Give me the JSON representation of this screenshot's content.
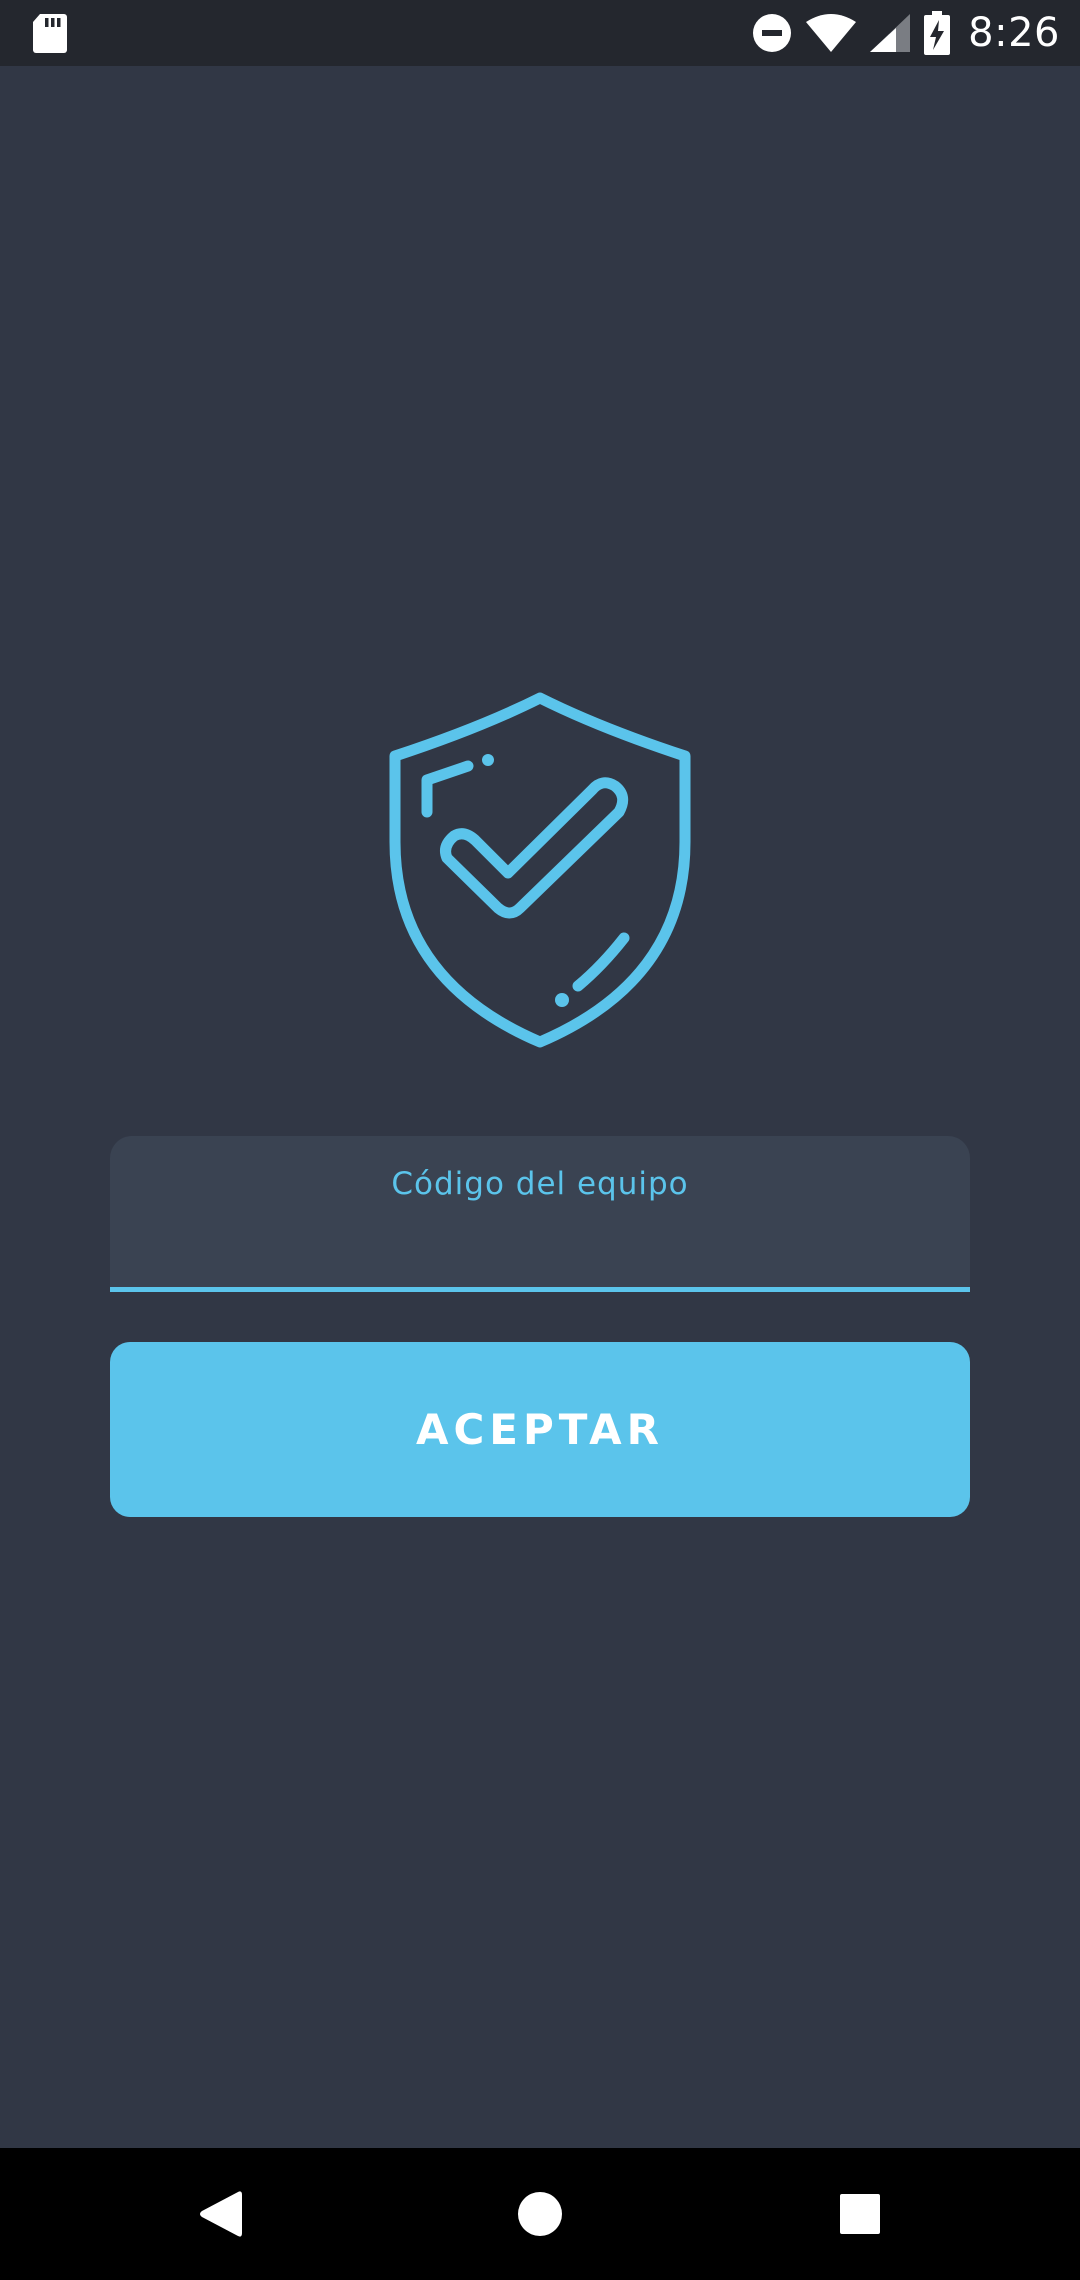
{
  "status_bar": {
    "time": "8:26",
    "icons": [
      "sd-card-icon",
      "do-not-disturb-icon",
      "wifi-icon",
      "signal-icon",
      "battery-charging-icon"
    ]
  },
  "logo": {
    "icon": "shield-check-icon"
  },
  "form": {
    "code_label": "Código del equipo",
    "code_value": "",
    "accept_label": "ACEPTAR"
  },
  "nav_bar": {
    "icons": [
      "back-icon",
      "home-icon",
      "recents-icon"
    ]
  },
  "colors": {
    "background": "#313745",
    "accent": "#5bc4eb",
    "input_background": "#3a4352",
    "status_bar": "#24272e",
    "nav_bar": "#000000"
  }
}
